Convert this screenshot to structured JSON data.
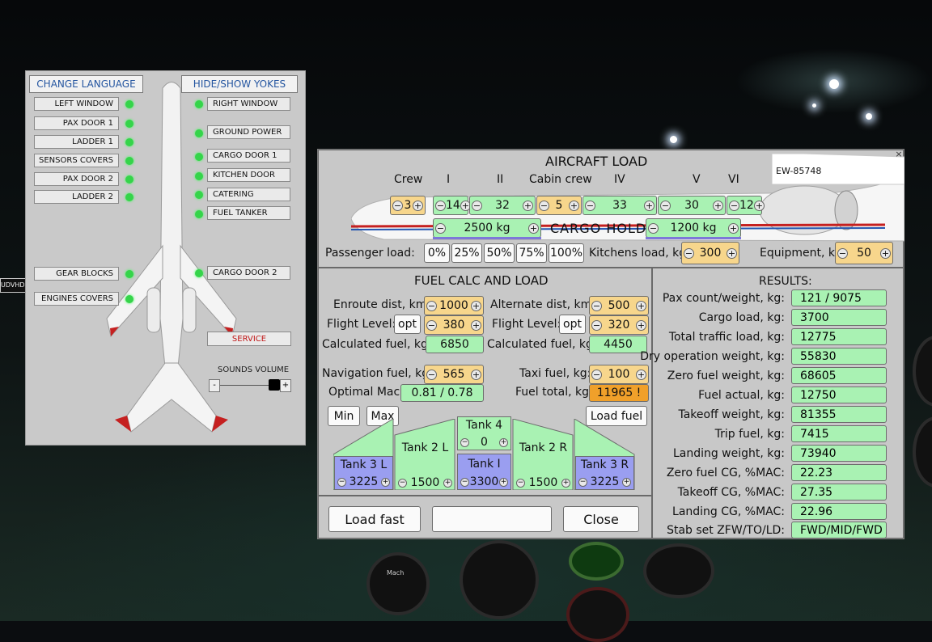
{
  "left_panel": {
    "change_language": "CHANGE LANGUAGE",
    "hide_show_yokes": "HIDE/SHOW YOKES",
    "left_items": [
      "LEFT WINDOW",
      "PAX DOOR 1",
      "LADDER 1",
      "SENSORS COVERS",
      "PAX DOOR 2",
      "LADDER 2",
      "GEAR BLOCKS",
      "ENGINES COVERS"
    ],
    "right_items": [
      "RIGHT WINDOW",
      "GROUND POWER",
      "CARGO DOOR 1",
      "KITCHEN DOOR",
      "CATERING",
      "FUEL TANKER",
      "CARGO DOOR 2"
    ],
    "service": "SERVICE",
    "sounds_volume": "SOUNDS VOLUME",
    "vol_minus": "-",
    "vol_plus": "+",
    "sounds_volume_level": 0.85,
    "led_color": "#35d44a"
  },
  "aircraft_load": {
    "title": "AIRCRAFT LOAD",
    "registration": "EW-85748",
    "headers": {
      "crew": "Crew",
      "s1": "I",
      "s2": "II",
      "cabin": "Cabin crew",
      "s4": "IV",
      "s5": "V",
      "s6": "VI"
    },
    "values": {
      "crew": "3",
      "s1": "14",
      "s2": "32",
      "cabin": "5",
      "s4": "33",
      "s5": "30",
      "s6": "12"
    },
    "cargo_label": "CARGO HOLDS",
    "cargo_fwd": "2500 kg",
    "cargo_aft": "1200 kg",
    "passenger_load_label": "Passenger load:",
    "pct_buttons": [
      "0%",
      "25%",
      "50%",
      "75%",
      "100%"
    ],
    "kitchens_label": "Kitchens load, kg:",
    "kitchens_value": "300",
    "equipment_label": "Equipment, kg:",
    "equipment_value": "50"
  },
  "fuel": {
    "title": "FUEL CALC AND LOAD",
    "enroute_label": "Enroute dist, km:",
    "enroute_value": "1000",
    "alternate_label": "Alternate dist, km:",
    "alternate_value": "500",
    "fl_label": "Flight Level:",
    "fl_opt": "opt",
    "fl_value": "380",
    "fl2_label": "Flight Level:",
    "fl2_opt": "opt",
    "fl2_value": "320",
    "calc_label": "Calculated fuel, kg:",
    "calc_value": "6850",
    "calc2_label": "Calculated fuel, kg:",
    "calc2_value": "4450",
    "nav_label": "Navigation fuel, kg:",
    "nav_value": "565",
    "taxi_label": "Taxi fuel, kg:",
    "taxi_value": "100",
    "mach_label": "Optimal Mach:",
    "mach_value": "0.81 / 0.78",
    "total_label": "Fuel total, kg:",
    "total_value": "11965 !",
    "min": "Min",
    "max": "Max",
    "load_fuel": "Load fuel",
    "tanks": {
      "t3l": {
        "label": "Tank 3 L",
        "value": "3225"
      },
      "t2l": {
        "label": "Tank 2 L",
        "value": "1500"
      },
      "t4": {
        "label": "Tank 4",
        "value": "0"
      },
      "t1": {
        "label": "Tank I",
        "value": "3300"
      },
      "t2r": {
        "label": "Tank 2 R",
        "value": "1500"
      },
      "t3r": {
        "label": "Tank 3 R",
        "value": "3225"
      }
    }
  },
  "bottom": {
    "load_fast": "Load fast",
    "status": "",
    "close": "Close"
  },
  "results": {
    "title": "RESULTS:",
    "rows": [
      {
        "label": "Pax count/weight, kg:",
        "value": "121 / 9075"
      },
      {
        "label": "Cargo load, kg:",
        "value": "3700"
      },
      {
        "label": "Total traffic load, kg:",
        "value": "12775"
      },
      {
        "label": "Dry operation weight, kg:",
        "value": "55830"
      },
      {
        "label": "Zero fuel weight, kg:",
        "value": "68605"
      },
      {
        "label": "Fuel actual, kg:",
        "value": "12750"
      },
      {
        "label": "Takeoff weight, kg:",
        "value": "81355"
      },
      {
        "label": "Trip fuel, kg:",
        "value": "7415"
      },
      {
        "label": "Landing weight, kg:",
        "value": "73940"
      },
      {
        "label": "Zero fuel CG, %MAC:",
        "value": "22.23"
      },
      {
        "label": "Takeoff CG, %MAC:",
        "value": "27.35"
      },
      {
        "label": "Landing CG, %MAC:",
        "value": "22.96"
      },
      {
        "label": "Stab set ZFW/TO/LD:",
        "value": "FWD/MID/FWD"
      }
    ]
  },
  "sim_bg": {
    "label1": "UDVHD",
    "mach": "Mach"
  }
}
